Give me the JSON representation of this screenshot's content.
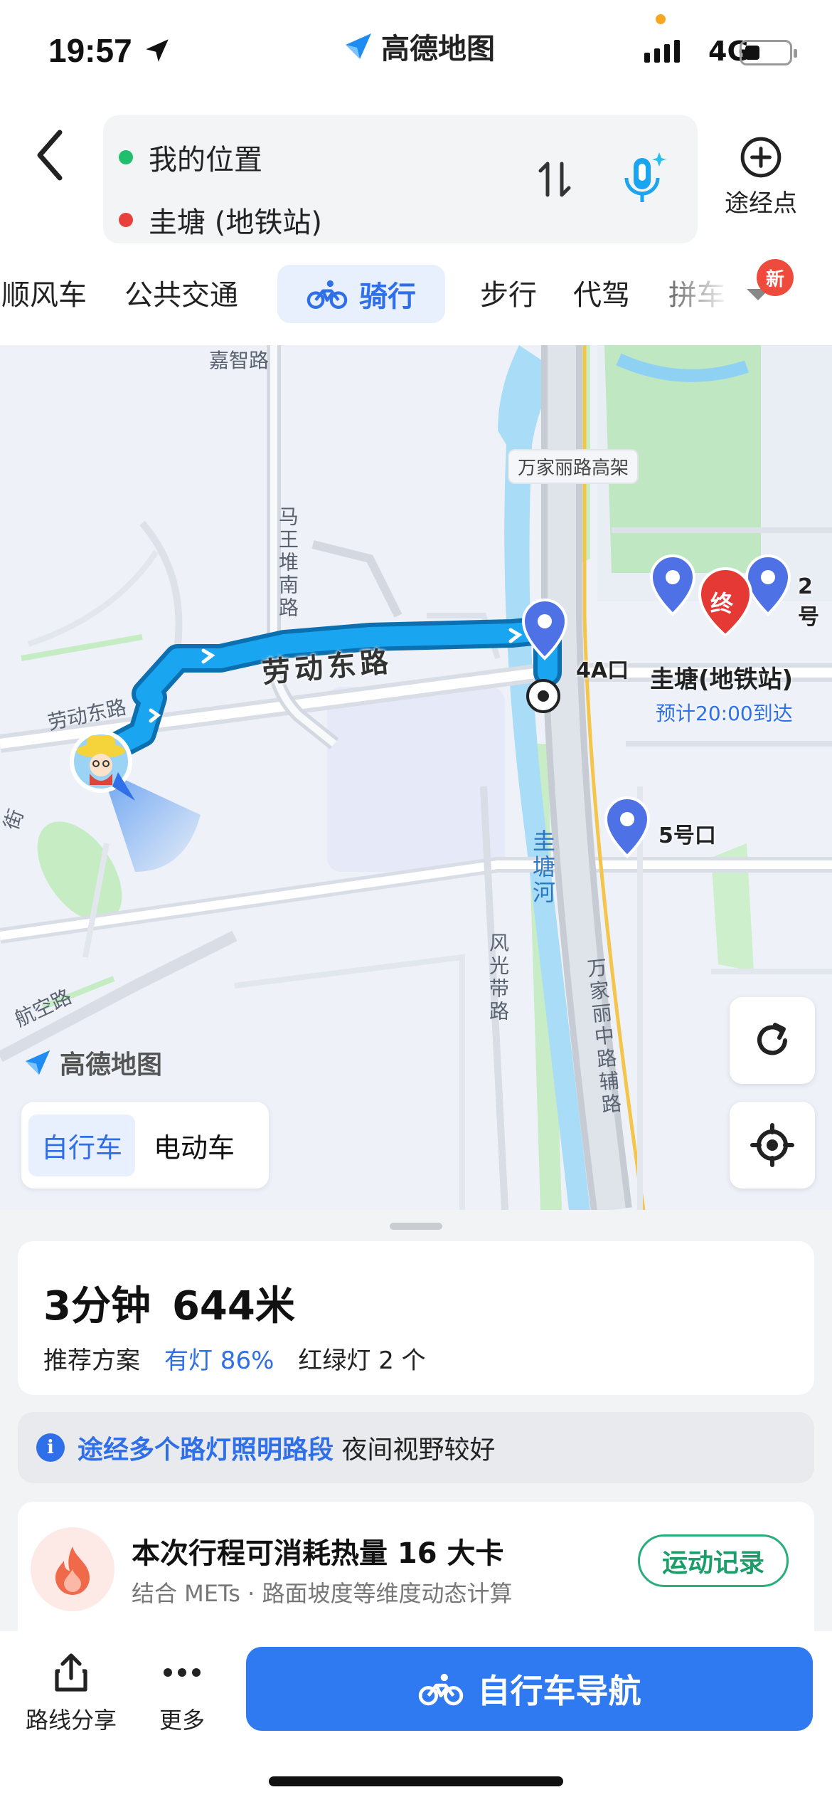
{
  "status_bar": {
    "time": "19:57",
    "app_name": "高德地图",
    "network": "4G"
  },
  "route": {
    "origin": "我的位置",
    "destination": "圭塘 (地铁站)",
    "origin_color": "#1fbf6c",
    "destination_color": "#e8413b",
    "waypoint_label": "途经点"
  },
  "tabs": {
    "items": [
      "顺风车",
      "公共交通",
      "骑行",
      "步行",
      "代驾",
      "拼车"
    ],
    "active": "骑行",
    "new_badge": "新"
  },
  "map": {
    "road_labels": {
      "jiazhi": "嘉智路",
      "mawangdui": "马王堆南路",
      "laodong_small": "劳动东路",
      "jie": "街",
      "hangkong": "航空路",
      "fengguangdai": "风光带路",
      "wanjiali_fudao": "万家丽中路辅路",
      "guitang_river": "圭塘河"
    },
    "elevated_label": "万家丽路高架",
    "route_road_name": "劳动东路",
    "exits": [
      "4A口",
      "2号",
      "5号口"
    ],
    "destination_marker": "终",
    "destination_name": "圭塘(地铁站)",
    "eta": "预计20:00到达",
    "watermark": "高德地图",
    "modes": [
      "自行车",
      "电动车"
    ],
    "active_mode": "自行车"
  },
  "summary": {
    "duration": "3分钟",
    "distance": "644米",
    "tag": "推荐方案",
    "lit_ratio": "有灯 86%",
    "traffic_lights": "红绿灯 2 个"
  },
  "notice": {
    "highlight": "途经多个路灯照明路段",
    "text": "夜间视野较好"
  },
  "calorie": {
    "title": "本次行程可消耗热量 16 大卡",
    "subtitle": "结合 METs · 路面坡度等维度动态计算",
    "button": "运动记录"
  },
  "bottom_bar": {
    "share": "路线分享",
    "more": "更多",
    "navigate": "自行车导航"
  },
  "colors": {
    "accent": "#2f7af0",
    "route": "#1aa5f0",
    "green": "#1d9d6a"
  }
}
